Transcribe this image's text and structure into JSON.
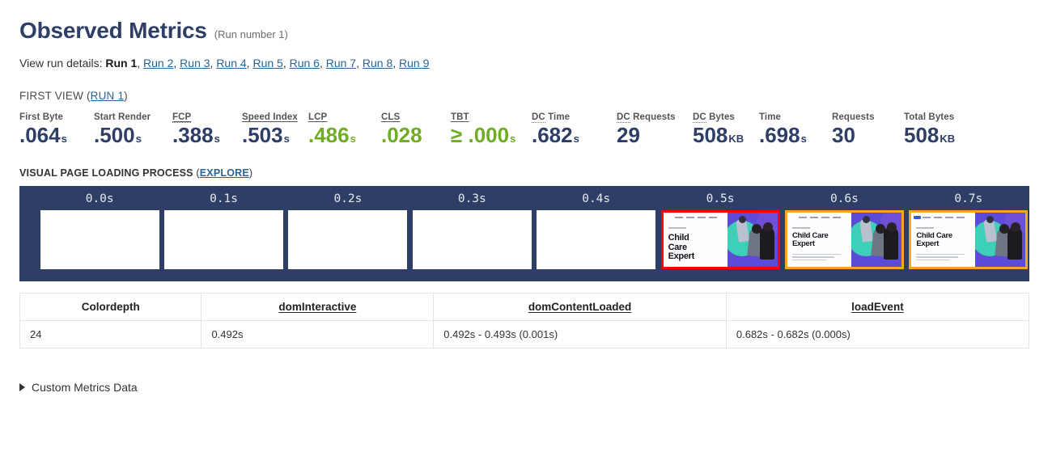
{
  "header": {
    "title": "Observed Metrics",
    "run_number": "(Run number 1)",
    "run_details_lead": "View run details:",
    "current_run": "Run 1",
    "other_runs": [
      "Run 2",
      "Run 3",
      "Run 4",
      "Run 5",
      "Run 6",
      "Run 7",
      "Run 8",
      "Run 9"
    ]
  },
  "first_view": {
    "label_prefix": "FIRST VIEW (",
    "run_link": "RUN 1",
    "label_suffix": ")"
  },
  "metrics": [
    {
      "label": "First Byte",
      "value": ".064",
      "unit": "s",
      "color": "navy",
      "underline": "none"
    },
    {
      "label": "Start Render",
      "value": ".500",
      "unit": "s",
      "color": "navy",
      "underline": "none"
    },
    {
      "label": "FCP",
      "value": ".388",
      "unit": "s",
      "color": "navy",
      "underline": "link-abbr"
    },
    {
      "label": "Speed Index",
      "value": ".503",
      "unit": "s",
      "color": "navy",
      "underline": "link"
    },
    {
      "label": "LCP",
      "value": ".486",
      "unit": "s",
      "color": "green",
      "underline": "link"
    },
    {
      "label": "CLS",
      "value": ".028",
      "unit": "",
      "color": "green",
      "underline": "link"
    },
    {
      "label": "TBT",
      "value": "≥ .000",
      "unit": "s",
      "color": "green",
      "underline": "link"
    },
    {
      "label": "DC Time",
      "value": ".682",
      "unit": "s",
      "color": "navy",
      "underline": "abbr-dc"
    },
    {
      "label": "DC Requests",
      "value": "29",
      "unit": "",
      "color": "navy",
      "underline": "abbr-dc"
    },
    {
      "label": "DC Bytes",
      "value": "508",
      "unit": "KB",
      "color": "navy",
      "underline": "abbr-dc"
    },
    {
      "label": "Time",
      "value": ".698",
      "unit": "s",
      "color": "navy",
      "underline": "none"
    },
    {
      "label": "Requests",
      "value": "30",
      "unit": "",
      "color": "navy",
      "underline": "none"
    },
    {
      "label": "Total Bytes",
      "value": "508",
      "unit": "KB",
      "color": "navy",
      "underline": "none"
    }
  ],
  "visual_loading": {
    "heading": "VISUAL PAGE LOADING PROCESS",
    "paren_open": "(",
    "explore_link": "EXPLORE",
    "paren_close": ")",
    "frames": [
      {
        "time": "0.0s",
        "state": "blank",
        "border": "none"
      },
      {
        "time": "0.1s",
        "state": "blank",
        "border": "none"
      },
      {
        "time": "0.2s",
        "state": "blank",
        "border": "none"
      },
      {
        "time": "0.3s",
        "state": "blank",
        "border": "none"
      },
      {
        "time": "0.4s",
        "state": "blank",
        "border": "none"
      },
      {
        "time": "0.5s",
        "state": "render",
        "border": "red",
        "headline": "Child\nCare\nExpert"
      },
      {
        "time": "0.6s",
        "state": "render",
        "border": "orange",
        "headline": "Child Care\nExpert"
      },
      {
        "time": "0.7s",
        "state": "render",
        "border": "orange",
        "headline": "Child Care\nExpert"
      }
    ]
  },
  "table": {
    "columns": [
      {
        "label": "Colordepth",
        "underlined": false
      },
      {
        "label": "domInteractive",
        "underlined": true
      },
      {
        "label": "domContentLoaded",
        "underlined": true
      },
      {
        "label": "loadEvent",
        "underlined": true
      }
    ],
    "rows": [
      [
        "24",
        "0.492s",
        "0.492s - 0.493s (0.001s)",
        "0.682s - 0.682s (0.000s)"
      ]
    ]
  },
  "footer": {
    "custom_metrics_label": "Custom Metrics Data",
    "triangle_icon": "triangle-right-icon"
  },
  "colors": {
    "navy": "#2e3e66",
    "green": "#70ac24",
    "link": "#2a6496",
    "filmstrip_bg": "#2e3e66",
    "border_red": "#ff0000",
    "border_orange": "#f5a623"
  }
}
